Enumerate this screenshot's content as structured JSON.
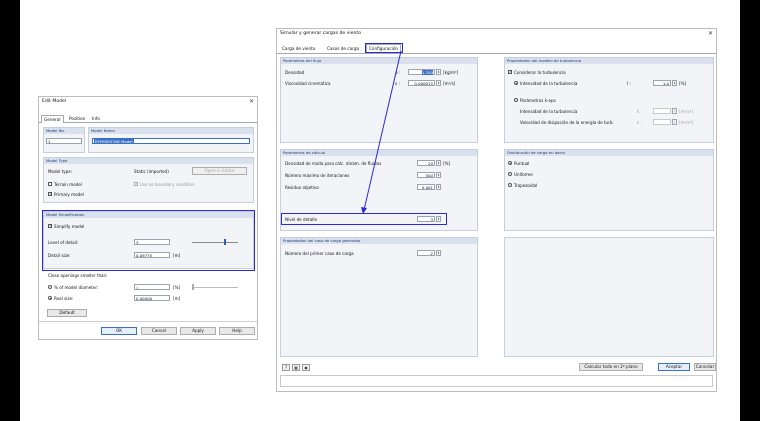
{
  "edit": {
    "title": "Edit Model",
    "tabs": [
      "General",
      "Position",
      "Info"
    ],
    "model_no_label": "Model No.",
    "model_no": "1",
    "model_name_label": "Model Name",
    "model_name": "RFEM/RSTAB Model",
    "model_type_header": "Model Type",
    "model_type_label": "Model type:",
    "model_type_value": "Static (imported)",
    "open_editor": "Open in Editor",
    "terrain_model": "Terrain model",
    "use_boundary": "Use as boundary condition",
    "primary_model": "Primary model",
    "simplification_header": "Model Simplification",
    "simplify": "Simplify model",
    "level_label": "Level of detail:",
    "level_value": "3",
    "detail_label": "Detail size:",
    "detail_value": "0.09775",
    "detail_unit": "[m]",
    "close_header": "Close openings smaller than:",
    "pct_label": "% of model diameter:",
    "pct_value": "0",
    "pct_unit": "[%]",
    "real_label": "Real size:",
    "real_value": "0.00000",
    "real_unit": "[m]",
    "default_btn": "Default",
    "ok": "OK",
    "cancel": "Cancel",
    "apply": "Apply",
    "help": "Help"
  },
  "sim": {
    "title": "Simular y generar cargas de viento",
    "tabs": [
      "Carga de viento",
      "Casos de carga",
      "Configuración"
    ],
    "flow_header": "Parámetros del flujo",
    "density_label": "Densidad",
    "density_sym": "ρ :",
    "density_value": "1.250",
    "density_unit": "[kg/m³]",
    "visc_label": "Viscosidad cinemática",
    "visc_sym": "ν :",
    "visc_value": "0.000015",
    "visc_unit": "[m²/s]",
    "turb_header": "Propiedades del modelo de turbulencia",
    "consider_turb": "Considerar la turbulencia",
    "turb_intensity": "Intensidad de la turbulencia",
    "turb_sym": "I :",
    "turb_value": "1.0",
    "turb_unit": "[%]",
    "keps": "Parámetros k-eps",
    "keps_int": "Intensidad de la turbulencia",
    "keps_int_sym": "k :",
    "keps_int_unit": "[m²/s²]",
    "keps_diss": "Velocidad de disipación de la energía de turb.",
    "keps_diss_sym": "ε :",
    "keps_diss_unit": "[m²/s³]",
    "calc_header": "Parámetros de cálculo",
    "mesh_label": "Densidad de malla para cálc. dinám. de fluidos",
    "mesh_value": "20",
    "mesh_unit": "[%]",
    "iter_label": "Número máximo de iteraciones",
    "iter_value": "500",
    "resid_label": "Residuo objetivo",
    "resid_value": "0.001",
    "detail_label": "Nivel de detalle",
    "detail_value": "3",
    "dist_header": "Distribución de carga en barra",
    "dist_options": [
      "Puntual",
      "Uniforme",
      "Trapezoidal"
    ],
    "props_header": "Propiedades del caso de carga generado",
    "first_case_label": "Número del primer caso de carga",
    "first_case_value": "2",
    "calc_all": "Calcular todo en 2º plano",
    "accept": "Aceptar",
    "cancel": "Cancelar"
  },
  "colors": {
    "highlight": "#2a2ad8",
    "accent": "#3a6fc4"
  }
}
